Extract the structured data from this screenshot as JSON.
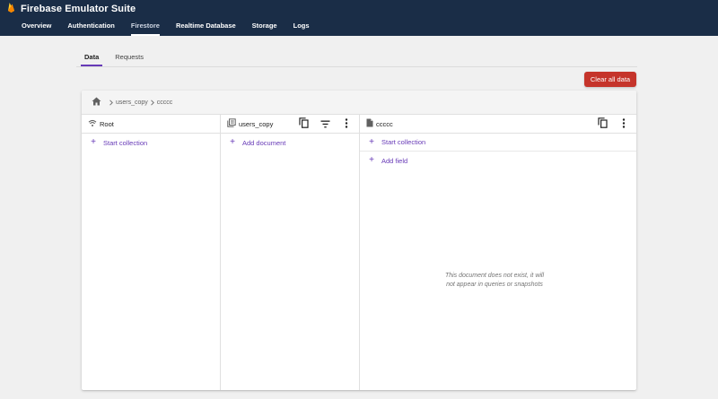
{
  "app": {
    "title": "Firebase Emulator Suite",
    "nav": [
      {
        "label": "Overview",
        "active": false
      },
      {
        "label": "Authentication",
        "active": false
      },
      {
        "label": "Firestore",
        "active": true
      },
      {
        "label": "Realtime Database",
        "active": false
      },
      {
        "label": "Storage",
        "active": false
      },
      {
        "label": "Logs",
        "active": false
      }
    ]
  },
  "subtabs": [
    {
      "label": "Data",
      "active": true
    },
    {
      "label": "Requests",
      "active": false
    }
  ],
  "toolbar": {
    "clear_label": "Clear all data"
  },
  "breadcrumb": {
    "items": [
      "users_copy",
      "ccccc"
    ]
  },
  "columns": {
    "root": {
      "title": "Root",
      "start_collection": "Start collection"
    },
    "collection": {
      "title": "users_copy",
      "add_document": "Add document"
    },
    "document": {
      "title": "ccccc",
      "start_collection": "Start collection",
      "add_field": "Add field",
      "empty_line1": "This document does not exist, it will",
      "empty_line2": "not appear in queries or snapshots"
    }
  },
  "colors": {
    "header_bg": "#1a2d47",
    "accent": "#673ab7",
    "danger": "#c5342b"
  }
}
